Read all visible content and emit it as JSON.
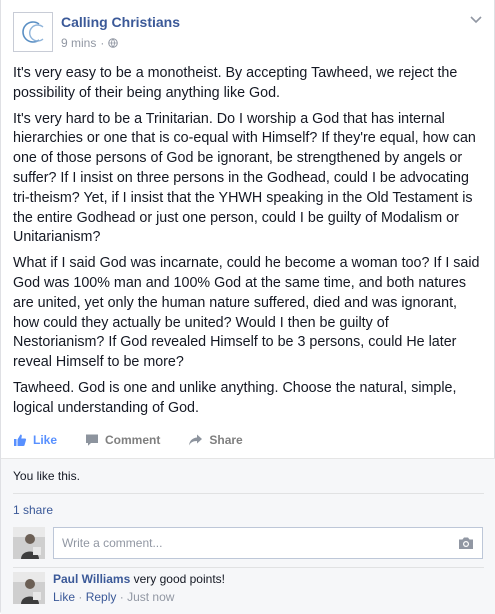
{
  "post": {
    "page_name": "Calling Christians",
    "avatar_initials": "CC",
    "time": "9 mins",
    "separator": "·",
    "paragraphs": [
      "It's very easy to be a monotheist. By accepting Tawheed, we reject the possibility of their being anything like God.",
      "It's very hard to be a Trinitarian. Do I worship a God that has internal hierarchies or one that is co-equal with Himself? If they're equal, how can one of those persons of God be ignorant, be strengthened by angels or suffer? If I insist on three persons in the Godhead, could I be advocating tri-theism? Yet, if I insist that the YHWH speaking in the Old Testament is the entire Godhead or just one person, could I be guilty of Modalism or Unitarianism?",
      "What if I said God was incarnate, could he become a woman too? If I said God was 100% man and 100% God at the same time, and both natures are united, yet only the human nature suffered, died and was ignorant, how could they actually be united? Would I then be guilty of Nestorianism? If God revealed Himself to be 3 persons, could He later reveal Himself to be more?",
      "Tawheed. God is one and unlike anything. Choose the natural, simple, logical understanding of God."
    ]
  },
  "actions": {
    "like": "Like",
    "comment": "Comment",
    "share": "Share"
  },
  "ufi": {
    "likes_text": "You like this.",
    "shares_text": "1 share",
    "comment_placeholder": "Write a comment...",
    "comments": [
      {
        "author": "Paul Williams",
        "text": "very good points!",
        "like_label": "Like",
        "reply_label": "Reply",
        "time": "Just now"
      }
    ]
  },
  "colors": {
    "link_blue": "#3b5998",
    "like_blue": "#5890ff",
    "muted": "#9197a3"
  }
}
